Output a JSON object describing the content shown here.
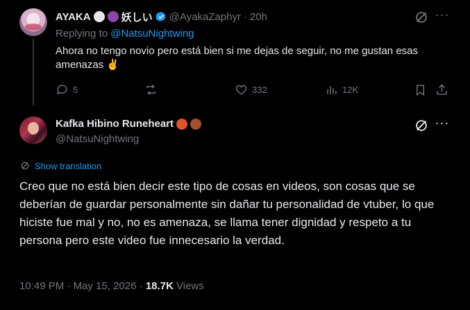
{
  "parent_tweet": {
    "display_name": "AYAKA",
    "name_suffix": "妖しい",
    "handle": "@AyakaZaphyr",
    "separator": "·",
    "time": "20h",
    "replying_prefix": "Replying to",
    "replying_handle": "@NatsuNightwing",
    "text": "Ahora no tengo novio pero está bien si me dejas de seguir, no me gustan esas amenazas ✌️",
    "replies": "5",
    "reposts": "",
    "likes": "332",
    "views": "12K"
  },
  "main_tweet": {
    "display_name": "Kafka Hibino Runeheart",
    "handle": "@NatsuNightwing",
    "show_translation": "Show translation",
    "text": "Creo que no está bien decir este tipo de cosas en videos, son cosas que se deberían de guardar personalmente sin dañar tu personalidad de vtuber, lo que hiciste fue mal y no, no es amenaza, se llama tener dignidad y respeto a tu persona pero este video fue innecesario la verdad.",
    "time": "10:49 PM",
    "separator": "·",
    "date": "May 15, 2026",
    "view_count": "18.7K",
    "views_label": "Views"
  },
  "colors": {
    "background": "#000000",
    "text": "#e7e9ea",
    "muted": "#71767b",
    "link": "#1d9bf0"
  }
}
